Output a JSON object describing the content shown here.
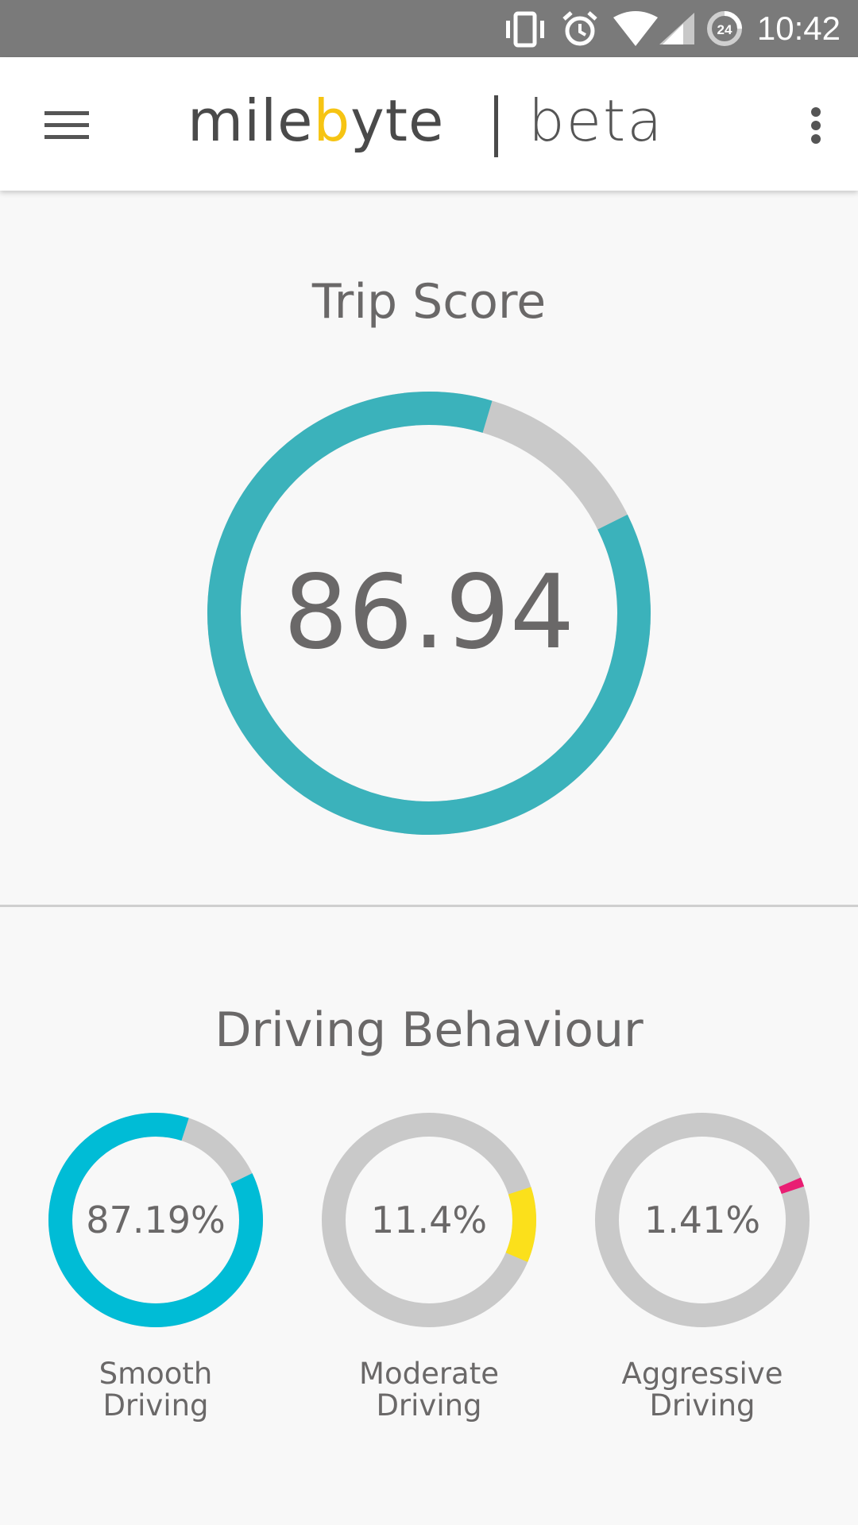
{
  "status_bar": {
    "time": "10:42",
    "battery_level": "24",
    "icons": [
      "vibrate-icon",
      "alarm-icon",
      "wifi-icon",
      "cell-signal-icon",
      "battery-saver-icon"
    ]
  },
  "app_bar": {
    "logo_prefix": "mile",
    "logo_accent": "b",
    "logo_suffix": "yte",
    "logo_tag": "beta",
    "menu_icon": "hamburger-menu-icon",
    "overflow_icon": "more-vert-icon"
  },
  "trip_score": {
    "title": "Trip Score",
    "value": "86.94",
    "fill_fraction": 0.8694,
    "color": "#3bb2bb"
  },
  "driving_behaviour": {
    "title": "Driving Behaviour",
    "items": [
      {
        "value": "87.19%",
        "line1": "Smooth",
        "line2": "Driving",
        "fraction": 0.8719,
        "start_fraction": 0.0,
        "color": "#00bcd6"
      },
      {
        "value": "11.4%",
        "line1": "Moderate",
        "line2": "Driving",
        "fraction": 0.114,
        "start_fraction": 0.8719,
        "color": "#fbe01b"
      },
      {
        "value": "1.41%",
        "line1": "Aggressive",
        "line2": "Driving",
        "fraction": 0.0141,
        "start_fraction": 0.9859,
        "color": "#e91e73"
      }
    ]
  },
  "colors": {
    "track": "#c9c9c9",
    "text": "#6a6868",
    "logo_accent": "#f6c413"
  }
}
